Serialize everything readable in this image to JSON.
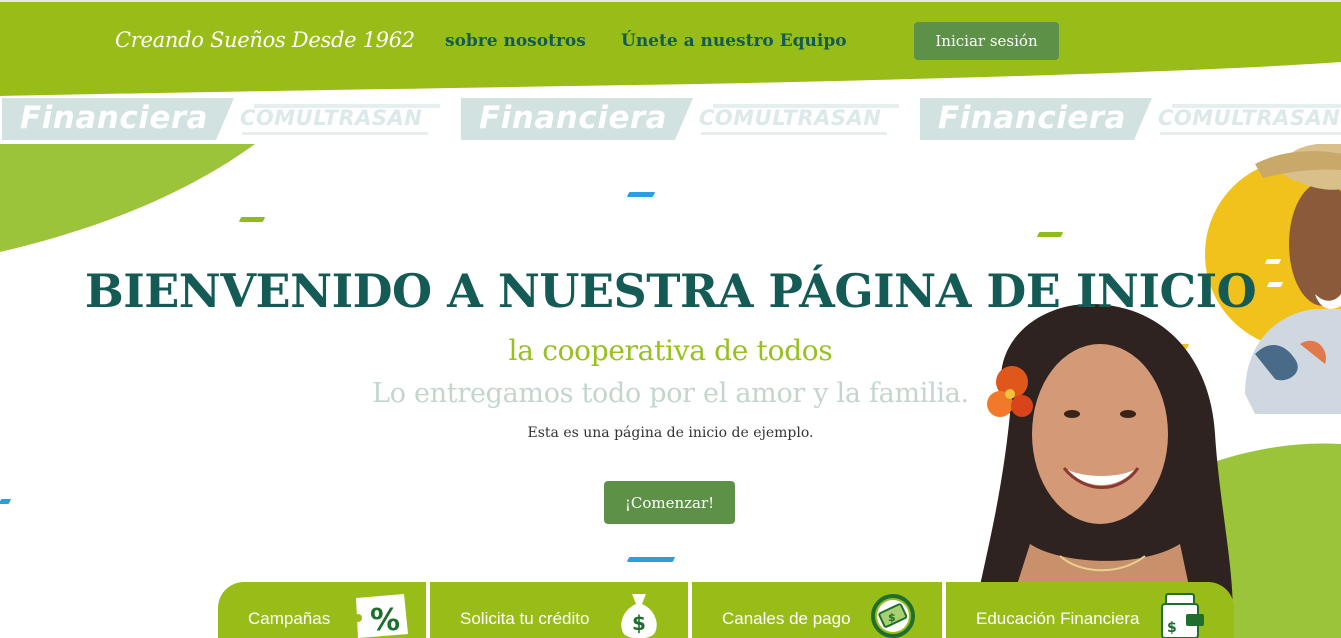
{
  "header": {
    "tagline": "Creando Sueños Desde 1962",
    "nav": [
      {
        "label": "sobre nosotros"
      },
      {
        "label": "Únete a nuestro Equipo"
      }
    ],
    "login_label": "Iniciar sesión",
    "colors": {
      "bar": "#98bd19",
      "link": "#145a55",
      "button": "#5e9148"
    }
  },
  "logo_strip": {
    "units": [
      {
        "primary": "Financiera",
        "secondary": "COMULTRASAN"
      },
      {
        "primary": "Financiera",
        "secondary": "COMULTRASAN"
      },
      {
        "primary": "Financiera",
        "secondary": "COMULTRASAN"
      }
    ]
  },
  "hero": {
    "title": "BIENVENIDO A NUESTRA PÁGINA DE INICIO",
    "subtitle": "la cooperativa de todos",
    "tagline": "Lo entregamos todo por el amor y la familia.",
    "description": "Esta es una página de inicio de ejemplo.",
    "cta_label": "¡Comenzar!",
    "colors": {
      "title": "#145a55",
      "subtitle": "#98c020",
      "tagline": "#c4d6cc"
    }
  },
  "services": [
    {
      "label": "Campañas",
      "icon": "percent-tag-icon"
    },
    {
      "label": "Solicita tu crédito",
      "icon": "money-bag-icon"
    },
    {
      "label": "Canales de pago",
      "icon": "cash-cycle-icon"
    },
    {
      "label": "Educación Financiera",
      "icon": "wallet-card-icon"
    }
  ]
}
